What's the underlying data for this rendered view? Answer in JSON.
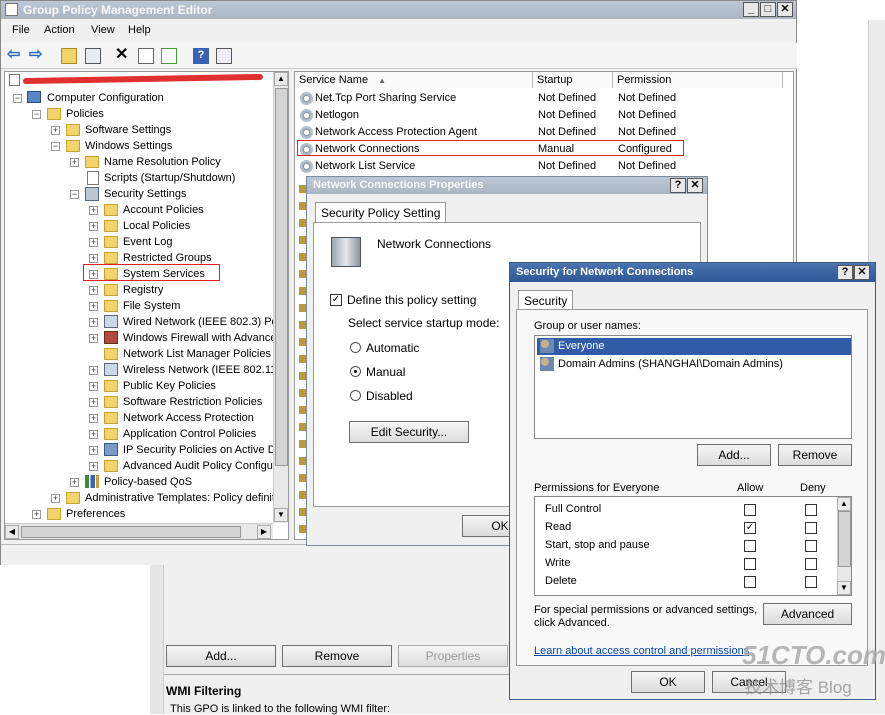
{
  "main_window": {
    "title": "Group Policy Management Editor",
    "menu": [
      "File",
      "Action",
      "View",
      "Help"
    ]
  },
  "tree": {
    "items": [
      {
        "label": "Computer Configuration"
      },
      {
        "label": "Policies"
      },
      {
        "label": "Software Settings"
      },
      {
        "label": "Windows Settings"
      },
      {
        "label": "Name Resolution Policy"
      },
      {
        "label": "Scripts (Startup/Shutdown)"
      },
      {
        "label": "Security Settings"
      },
      {
        "label": "Account Policies"
      },
      {
        "label": "Local Policies"
      },
      {
        "label": "Event Log"
      },
      {
        "label": "Restricted Groups"
      },
      {
        "label": "System Services"
      },
      {
        "label": "Registry"
      },
      {
        "label": "File System"
      },
      {
        "label": "Wired Network (IEEE 802.3) Po"
      },
      {
        "label": "Windows Firewall with Advance"
      },
      {
        "label": "Network List Manager Policies"
      },
      {
        "label": "Wireless Network (IEEE 802.11"
      },
      {
        "label": "Public Key Policies"
      },
      {
        "label": "Software Restriction Policies"
      },
      {
        "label": "Network Access Protection"
      },
      {
        "label": "Application Control Policies"
      },
      {
        "label": "IP Security Policies on Active D"
      },
      {
        "label": "Advanced Audit Policy Configu"
      },
      {
        "label": "Policy-based QoS"
      },
      {
        "label": "Administrative Templates: Policy definit"
      },
      {
        "label": "Preferences"
      }
    ]
  },
  "services": {
    "headers": {
      "name": "Service Name",
      "startup": "Startup",
      "permission": "Permission"
    },
    "rows": [
      {
        "name": "Net.Tcp Port Sharing Service",
        "startup": "Not Defined",
        "permission": "Not Defined"
      },
      {
        "name": "Netlogon",
        "startup": "Not Defined",
        "permission": "Not Defined"
      },
      {
        "name": "Network Access Protection Agent",
        "startup": "Not Defined",
        "permission": "Not Defined"
      },
      {
        "name": "Network Connections",
        "startup": "Manual",
        "permission": "Configured"
      },
      {
        "name": "Network List Service",
        "startup": "Not Defined",
        "permission": "Not Defined"
      }
    ]
  },
  "props_dialog": {
    "title": "Network Connections Properties",
    "tab": "Security Policy Setting",
    "service_name": "Network Connections",
    "define_label": "Define this policy setting",
    "mode_label": "Select service startup mode:",
    "options": [
      "Automatic",
      "Manual",
      "Disabled"
    ],
    "selected": "Manual",
    "edit_button": "Edit Security...",
    "ok_button": "OK"
  },
  "security_dialog": {
    "title": "Security for Network Connections",
    "tab": "Security",
    "group_label": "Group or user names:",
    "users": [
      "Everyone",
      "Domain Admins (SHANGHAI\\Domain Admins)"
    ],
    "add_button": "Add...",
    "remove_button": "Remove",
    "perm_label": "Permissions for Everyone",
    "allow_label": "Allow",
    "deny_label": "Deny",
    "permissions": [
      {
        "name": "Full Control",
        "allow": false,
        "deny": false
      },
      {
        "name": "Read",
        "allow": true,
        "deny": false
      },
      {
        "name": "Start, stop and pause",
        "allow": false,
        "deny": false
      },
      {
        "name": "Write",
        "allow": false,
        "deny": false
      },
      {
        "name": "Delete",
        "allow": false,
        "deny": false
      }
    ],
    "special_text_1": "For special permissions or advanced settings,",
    "special_text_2": "click Advanced.",
    "advanced_button": "Advanced",
    "link": "Learn about access control and permissions",
    "ok_button": "OK",
    "cancel_button": "Cancel"
  },
  "background": {
    "add_button": "Add...",
    "remove_button": "Remove",
    "properties_button": "Properties",
    "wmi_title": "WMI Filtering",
    "wmi_text": "This GPO is linked to the following WMI filter:"
  },
  "watermark": {
    "text": "51CTO.com",
    "sub": "技术博客 Blog"
  }
}
